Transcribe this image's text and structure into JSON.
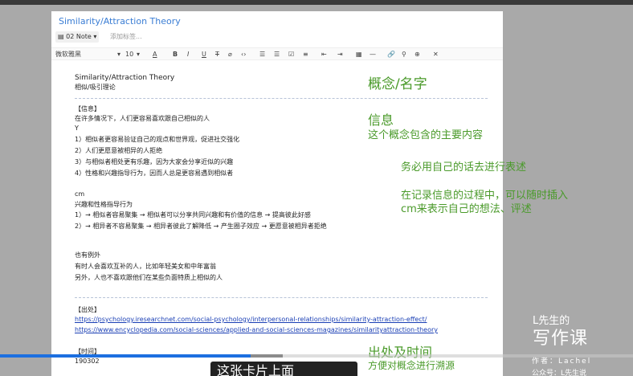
{
  "note": {
    "title": "Similarity/Attraction Theory",
    "notebook": "02 Note",
    "tag_placeholder": "添加标签...",
    "toolbar": {
      "font": "微软雅黑",
      "size": "10",
      "buttons": [
        "A",
        "B",
        "I",
        "U",
        "T",
        "⌀",
        "‹›",
        "☰",
        "☰",
        "☑",
        "≡",
        "⇤",
        "⇥",
        "▦",
        "—",
        "🔗",
        "⚲",
        "⊕",
        "✕"
      ]
    },
    "body": {
      "heading_en": "Similarity/Attraction Theory",
      "heading_cn": "相似/吸引理论",
      "info_header": "【信息】",
      "info_intro": "在许多情况下，人们更容易喜欢跟自己相似的人",
      "info_y": "Y",
      "info_items": [
        "1）相似者更容易验证自己的观点和世界观，促进社交强化",
        "2）人们更愿意被相异的人拒绝",
        "3）与相似者相处更有乐趣，因为大家会分享近似的兴趣",
        "4）性格和兴趣指导行为，因而人总是更容易遇到相似者"
      ],
      "cm_label": "cm",
      "cm_intro": "兴趣和性格指导行为",
      "cm_items": [
        "1）→ 相似者容易聚集 → 相似者可以分享共同兴趣和有价值的信息 → 提高彼此好感",
        "2）→ 相异者不容易聚集 → 相异者彼此了解降低 → 产生圈子效应 → 更愿意被相异者拒绝"
      ],
      "exception_label": "也有例外",
      "exception_items": [
        "有时人会喜欢互补的人，比如年轻美女和中年富翁",
        "另外，人也不喜欢跟他们在某些负面特质上相似的人"
      ],
      "source_header": "【出处】",
      "links": [
        "https://psychology.iresearchnet.com/social-psychology/interpersonal-relationships/similarity-attraction-effect/",
        "https://www.encyclopedia.com/social-sciences/applied-and-social-sciences-magazines/similarityattraction-theory"
      ],
      "time_header": "【时间】",
      "time_value": "190302"
    }
  },
  "annotations": {
    "concept": "概念/名字",
    "info_title": "信息",
    "info_desc": "这个概念包含的主要内容",
    "own_words": "务必用自己的话去进行表述",
    "cm_tip_1": "在记录信息的过程中，可以随时插入",
    "cm_tip_2": "cm来表示自己的想法、评述",
    "source_title": "出处及时间",
    "source_desc": "方便对概念进行溯源"
  },
  "branding": {
    "line1": "L先生的",
    "line2": "写作课",
    "author": "作者：Lachel",
    "account": "公众号：L先生说"
  },
  "video": {
    "progress": 0.396,
    "subtitle": "这张卡片上面"
  },
  "colors": {
    "annotation": "#4a9a2a",
    "link": "#1a3fb5",
    "progress": "#1c6fe0",
    "title": "#3a7dd4"
  }
}
